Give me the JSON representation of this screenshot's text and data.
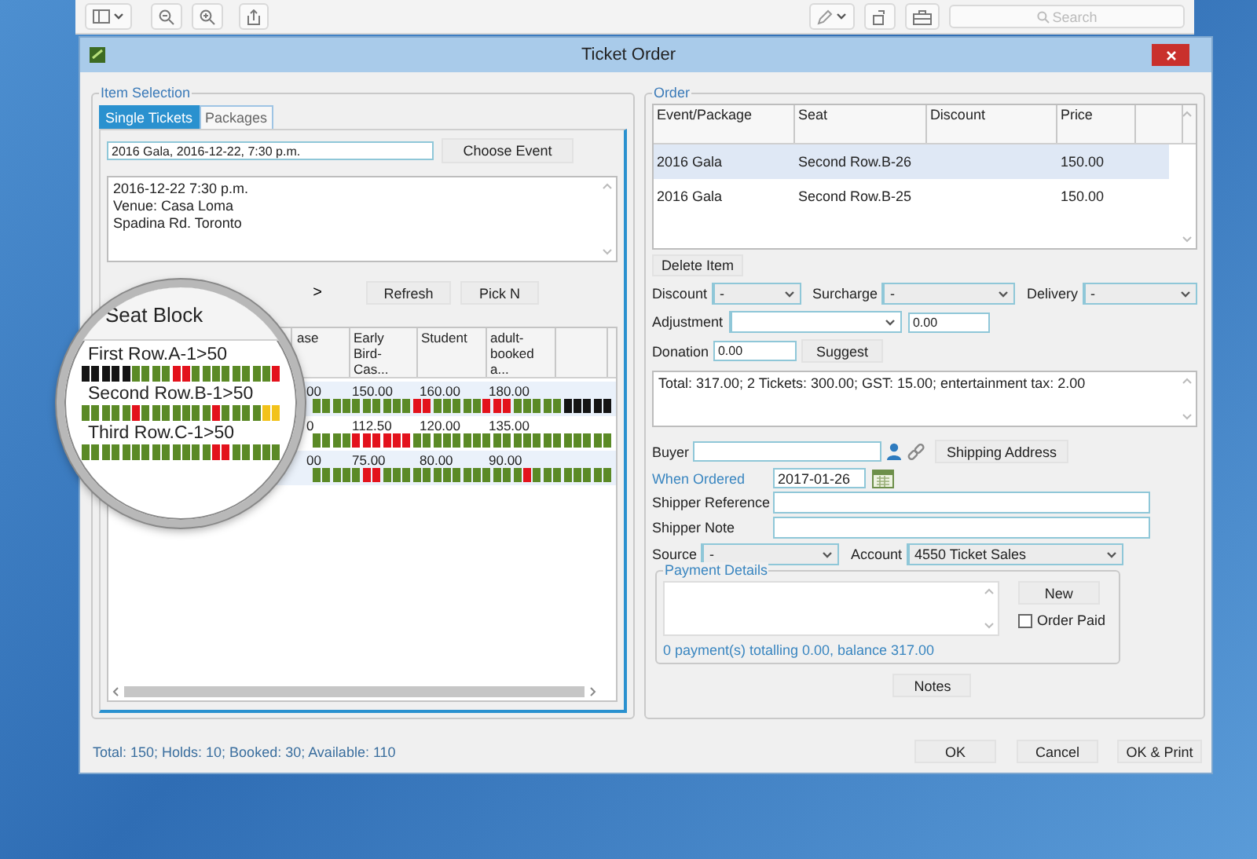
{
  "toolbar": {
    "search": {
      "placeholder": "Search"
    }
  },
  "window": {
    "title": "Ticket Order"
  },
  "item_selection": {
    "title": "Item Selection",
    "tabs": [
      {
        "label": "Single Tickets",
        "selected": true
      },
      {
        "label": "Packages",
        "selected": false
      }
    ],
    "event_field": {
      "value": "2016 Gala, 2016-12-22, 7:30 p.m."
    },
    "choose_button": "Choose Event",
    "event_details": [
      "2016-12-22 7:30 p.m.",
      "Venue: Casa Loma",
      "Spadina Rd. Toronto"
    ],
    "next_button": ">",
    "buttons": [
      "Refresh",
      "Pick N"
    ]
  },
  "seat_table": {
    "columns": [
      "ase",
      "Early Bird-Cas...",
      "Student",
      "adult-booked a..."
    ],
    "rows": [
      {
        "label": "First Row.A-1>50",
        "prices": [
          "00",
          "150.00",
          "160.00",
          "180.00"
        ],
        "seats": [
          {
            "color": "#141414"
          },
          {
            "color": "#141414"
          },
          {
            "color": "#141414"
          },
          {
            "color": "#141414"
          },
          {
            "color": "#141414"
          },
          {
            "color": "#5b8a26"
          },
          {
            "color": "#5b8a26"
          },
          {
            "color": "#5b8a26"
          },
          {
            "color": "#5b8a26"
          },
          {
            "color": "#e3121c"
          },
          {
            "color": "#e3121c"
          },
          {
            "color": "#5b8a26"
          },
          {
            "color": "#5b8a26"
          },
          {
            "color": "#5b8a26"
          },
          {
            "color": "#5b8a26"
          },
          {
            "color": "#5b8a26"
          },
          {
            "color": "#5b8a26"
          },
          {
            "color": "#5b8a26"
          },
          {
            "color": "#5b8a26"
          },
          {
            "color": "#e3121c"
          },
          {
            "color": "#5b8a26"
          },
          {
            "color": "#5b8a26"
          },
          {
            "color": "#5b8a26"
          },
          {
            "color": "#5b8a26"
          },
          {
            "color": "#5b8a26"
          },
          {
            "color": "#5b8a26"
          },
          {
            "color": "#5b8a26"
          },
          {
            "color": "#5b8a26"
          },
          {
            "color": "#5b8a26"
          },
          {
            "color": "#5b8a26"
          },
          {
            "color": "#e3121c"
          },
          {
            "color": "#e3121c"
          },
          {
            "color": "#5b8a26"
          },
          {
            "color": "#5b8a26"
          },
          {
            "color": "#5b8a26"
          },
          {
            "color": "#5b8a26"
          },
          {
            "color": "#5b8a26"
          },
          {
            "color": "#e3121c"
          },
          {
            "color": "#e3121c"
          },
          {
            "color": "#e3121c"
          },
          {
            "color": "#5b8a26"
          },
          {
            "color": "#5b8a26"
          },
          {
            "color": "#5b8a26"
          },
          {
            "color": "#5b8a26"
          },
          {
            "color": "#5b8a26"
          },
          {
            "color": "#141414"
          },
          {
            "color": "#141414"
          },
          {
            "color": "#141414"
          },
          {
            "color": "#141414"
          },
          {
            "color": "#141414"
          }
        ]
      },
      {
        "label": "Second Row.B-1>50",
        "prices": [
          "0",
          "112.50",
          "120.00",
          "135.00"
        ],
        "seats": [
          {
            "color": "#5b8a26"
          },
          {
            "color": "#5b8a26"
          },
          {
            "color": "#5b8a26"
          },
          {
            "color": "#5b8a26"
          },
          {
            "color": "#5b8a26"
          },
          {
            "color": "#e3121c"
          },
          {
            "color": "#5b8a26"
          },
          {
            "color": "#5b8a26"
          },
          {
            "color": "#5b8a26"
          },
          {
            "color": "#5b8a26"
          },
          {
            "color": "#5b8a26"
          },
          {
            "color": "#5b8a26"
          },
          {
            "color": "#5b8a26"
          },
          {
            "color": "#e3121c"
          },
          {
            "color": "#5b8a26"
          },
          {
            "color": "#5b8a26"
          },
          {
            "color": "#5b8a26"
          },
          {
            "color": "#5b8a26"
          },
          {
            "color": "#f2c21b"
          },
          {
            "color": "#f2c21b"
          },
          {
            "color": "#5b8a26"
          },
          {
            "color": "#5b8a26"
          },
          {
            "color": "#5b8a26"
          },
          {
            "color": "#5b8a26"
          },
          {
            "color": "#e3121c"
          },
          {
            "color": "#e3121c"
          },
          {
            "color": "#e3121c"
          },
          {
            "color": "#e3121c"
          },
          {
            "color": "#e3121c"
          },
          {
            "color": "#e3121c"
          },
          {
            "color": "#5b8a26"
          },
          {
            "color": "#5b8a26"
          },
          {
            "color": "#5b8a26"
          },
          {
            "color": "#5b8a26"
          },
          {
            "color": "#5b8a26"
          },
          {
            "color": "#5b8a26"
          },
          {
            "color": "#5b8a26"
          },
          {
            "color": "#5b8a26"
          },
          {
            "color": "#5b8a26"
          },
          {
            "color": "#5b8a26"
          },
          {
            "color": "#5b8a26"
          },
          {
            "color": "#5b8a26"
          },
          {
            "color": "#5b8a26"
          },
          {
            "color": "#5b8a26"
          },
          {
            "color": "#5b8a26"
          },
          {
            "color": "#5b8a26"
          },
          {
            "color": "#5b8a26"
          },
          {
            "color": "#5b8a26"
          },
          {
            "color": "#5b8a26"
          },
          {
            "color": "#5b8a26"
          }
        ]
      },
      {
        "label": "Third Row.C-1>50",
        "prices": [
          "00",
          "75.00",
          "80.00",
          "90.00"
        ],
        "seats": [
          {
            "color": "#5b8a26"
          },
          {
            "color": "#5b8a26"
          },
          {
            "color": "#5b8a26"
          },
          {
            "color": "#5b8a26"
          },
          {
            "color": "#5b8a26"
          },
          {
            "color": "#5b8a26"
          },
          {
            "color": "#5b8a26"
          },
          {
            "color": "#5b8a26"
          },
          {
            "color": "#5b8a26"
          },
          {
            "color": "#5b8a26"
          },
          {
            "color": "#5b8a26"
          },
          {
            "color": "#5b8a26"
          },
          {
            "color": "#5b8a26"
          },
          {
            "color": "#e3121c"
          },
          {
            "color": "#e3121c"
          },
          {
            "color": "#5b8a26"
          },
          {
            "color": "#5b8a26"
          },
          {
            "color": "#5b8a26"
          },
          {
            "color": "#5b8a26"
          },
          {
            "color": "#5b8a26"
          },
          {
            "color": "#5b8a26"
          },
          {
            "color": "#5b8a26"
          },
          {
            "color": "#5b8a26"
          },
          {
            "color": "#5b8a26"
          },
          {
            "color": "#5b8a26"
          },
          {
            "color": "#e3121c"
          },
          {
            "color": "#e3121c"
          },
          {
            "color": "#5b8a26"
          },
          {
            "color": "#5b8a26"
          },
          {
            "color": "#5b8a26"
          },
          {
            "color": "#5b8a26"
          },
          {
            "color": "#5b8a26"
          },
          {
            "color": "#5b8a26"
          },
          {
            "color": "#5b8a26"
          },
          {
            "color": "#5b8a26"
          },
          {
            "color": "#5b8a26"
          },
          {
            "color": "#5b8a26"
          },
          {
            "color": "#5b8a26"
          },
          {
            "color": "#5b8a26"
          },
          {
            "color": "#5b8a26"
          },
          {
            "color": "#5b8a26"
          },
          {
            "color": "#e3121c"
          },
          {
            "color": "#5b8a26"
          },
          {
            "color": "#5b8a26"
          },
          {
            "color": "#5b8a26"
          },
          {
            "color": "#5b8a26"
          },
          {
            "color": "#5b8a26"
          },
          {
            "color": "#5b8a26"
          },
          {
            "color": "#5b8a26"
          },
          {
            "color": "#5b8a26"
          }
        ]
      }
    ]
  },
  "magnifier": {
    "header": "Seat Block"
  },
  "status_text": "Total: 150; Holds: 10; Booked: 30; Available: 110",
  "order": {
    "title": "Order",
    "columns": [
      "Event/Package",
      "Seat",
      "Discount",
      "Price"
    ],
    "rows": [
      {
        "event": "2016 Gala",
        "seat": "Second Row.B-26",
        "price": "150.00",
        "selected": true
      },
      {
        "event": "2016 Gala",
        "seat": "Second Row.B-25",
        "price": "150.00",
        "selected": false
      }
    ],
    "delete_button": "Delete Item",
    "discount": {
      "label": "Discount",
      "value": "-"
    },
    "surcharge": {
      "label": "Surcharge",
      "value": "-"
    },
    "delivery": {
      "label": "Delivery",
      "value": "-"
    },
    "adjustment": {
      "label": "Adjustment",
      "amount": "0.00"
    },
    "donation": {
      "label": "Donation",
      "value": "0.00",
      "button": "Suggest"
    },
    "summary": "Total: 317.00; 2 Tickets: 300.00; GST: 15.00; entertainment tax: 2.00",
    "buyer": {
      "label": "Buyer",
      "button": "Shipping Address"
    },
    "when_ordered": {
      "label": "When Ordered",
      "value": "2017-01-26"
    },
    "shipper_reference": {
      "label": "Shipper Reference"
    },
    "shipper_note": {
      "label": "Shipper Note"
    },
    "source": {
      "label": "Source",
      "value": "-"
    },
    "account": {
      "label": "Account",
      "value": "4550 Ticket Sales"
    },
    "payment_details": {
      "title": "Payment Details",
      "new_button": "New",
      "order_paid": {
        "label": "Order Paid",
        "checked": false
      },
      "status": "0 payment(s) totalling 0.00, balance 317.00"
    },
    "notes_button": "Notes"
  },
  "dialog_buttons": [
    "OK",
    "Cancel",
    "OK & Print"
  ]
}
